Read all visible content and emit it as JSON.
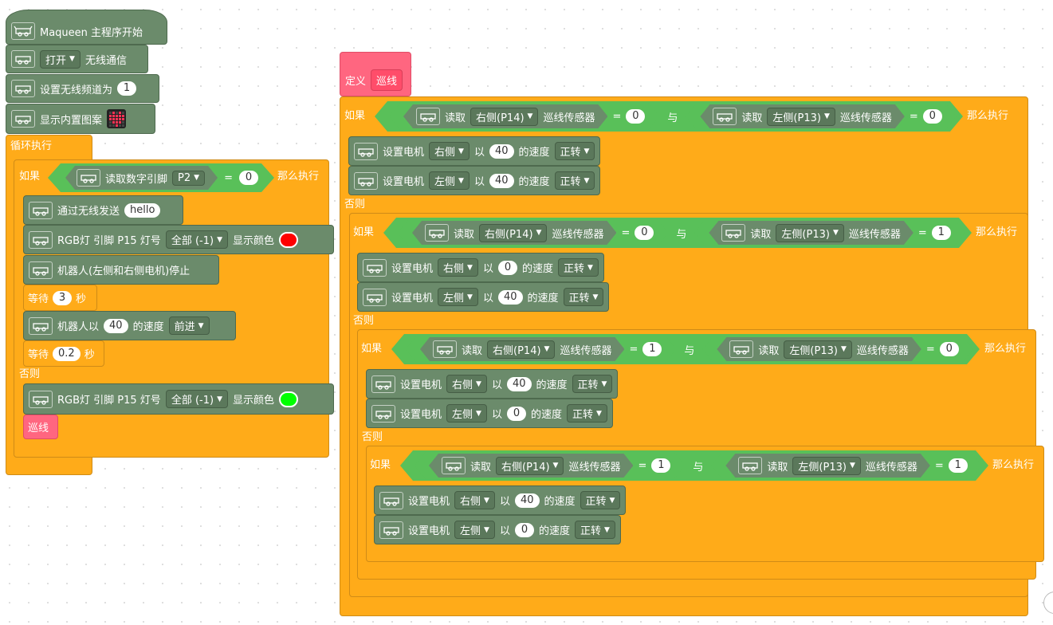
{
  "colors": {
    "control": "#FFAB19",
    "robot": "#6B8B6B",
    "operator": "#59C059",
    "custom": "#FF6680",
    "led_red": "#FF0000",
    "led_green": "#00FF00"
  },
  "icons": {
    "robot": "maqueen-car-icon"
  },
  "main": {
    "start": "Maqueen 主程序开始",
    "open_opt": "打开",
    "wireless": "无线通信",
    "set_channel": "设置无线频道为",
    "channel_val": "1",
    "show_image": "显示内置图案",
    "loop": "循环执行",
    "if_label": "如果",
    "read_pin": "读取数字引脚",
    "pin_opt": "P2",
    "eq": "=",
    "eq_val": "0",
    "then": "那么执行",
    "send": "通过无线发送",
    "send_val": "hello",
    "rgb": "RGB灯 引脚 P15 灯号",
    "rgb_opt": "全部 (-1)",
    "show_color": "显示颜色",
    "stop": "机器人(左侧和右侧电机)停止",
    "wait": "等待",
    "wait1": "3",
    "sec": "秒",
    "robot_at": "机器人以",
    "speed40": "40",
    "speed_word": "的速度",
    "forward": "前进",
    "wait2": "0.2",
    "else": "否则",
    "call": "巡线"
  },
  "def": {
    "define": "定义",
    "name": "巡线",
    "if": "如果",
    "read": "读取",
    "right": "右侧(P14)",
    "left": "左侧(P13)",
    "sensor": "巡线传感器",
    "eq": "=",
    "and": "与",
    "then": "那么执行",
    "else": "否则",
    "set_motor": "设置电机",
    "m_right": "右侧",
    "m_left": "左侧",
    "by": "以",
    "speed": "的速度",
    "fwd": "正转",
    "conds": [
      [
        "0",
        "0"
      ],
      [
        "0",
        "1"
      ],
      [
        "1",
        "0"
      ],
      [
        "1",
        "1"
      ]
    ],
    "speeds": [
      [
        "40",
        "40"
      ],
      [
        "0",
        "40"
      ],
      [
        "40",
        "0"
      ],
      [
        "40",
        "0"
      ]
    ]
  }
}
